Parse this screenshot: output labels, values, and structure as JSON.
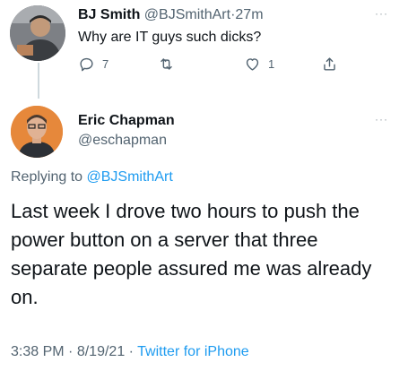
{
  "reply_tweet": {
    "author_name": "BJ Smith",
    "author_handle": "@BJSmithArt",
    "separator": "·",
    "time_ago": "27m",
    "text": "Why are IT guys such dicks?",
    "more": "···",
    "reply_count": "7",
    "retweet_count": "",
    "like_count": "1"
  },
  "main_tweet": {
    "author_name": "Eric Chapman",
    "author_handle": "@eschapman",
    "more": "···",
    "replying_prefix": "Replying to",
    "replying_handle": "@BJSmithArt",
    "text": "Last week I drove two hours to push the power button on a server that three separate people assured me was already on.",
    "time": "3:38 PM",
    "date": "8/19/21",
    "separator": "·",
    "source": "Twitter for iPhone"
  },
  "colors": {
    "link": "#1d9bf0",
    "secondary_text": "#536471",
    "primary_text": "#0f1419"
  }
}
